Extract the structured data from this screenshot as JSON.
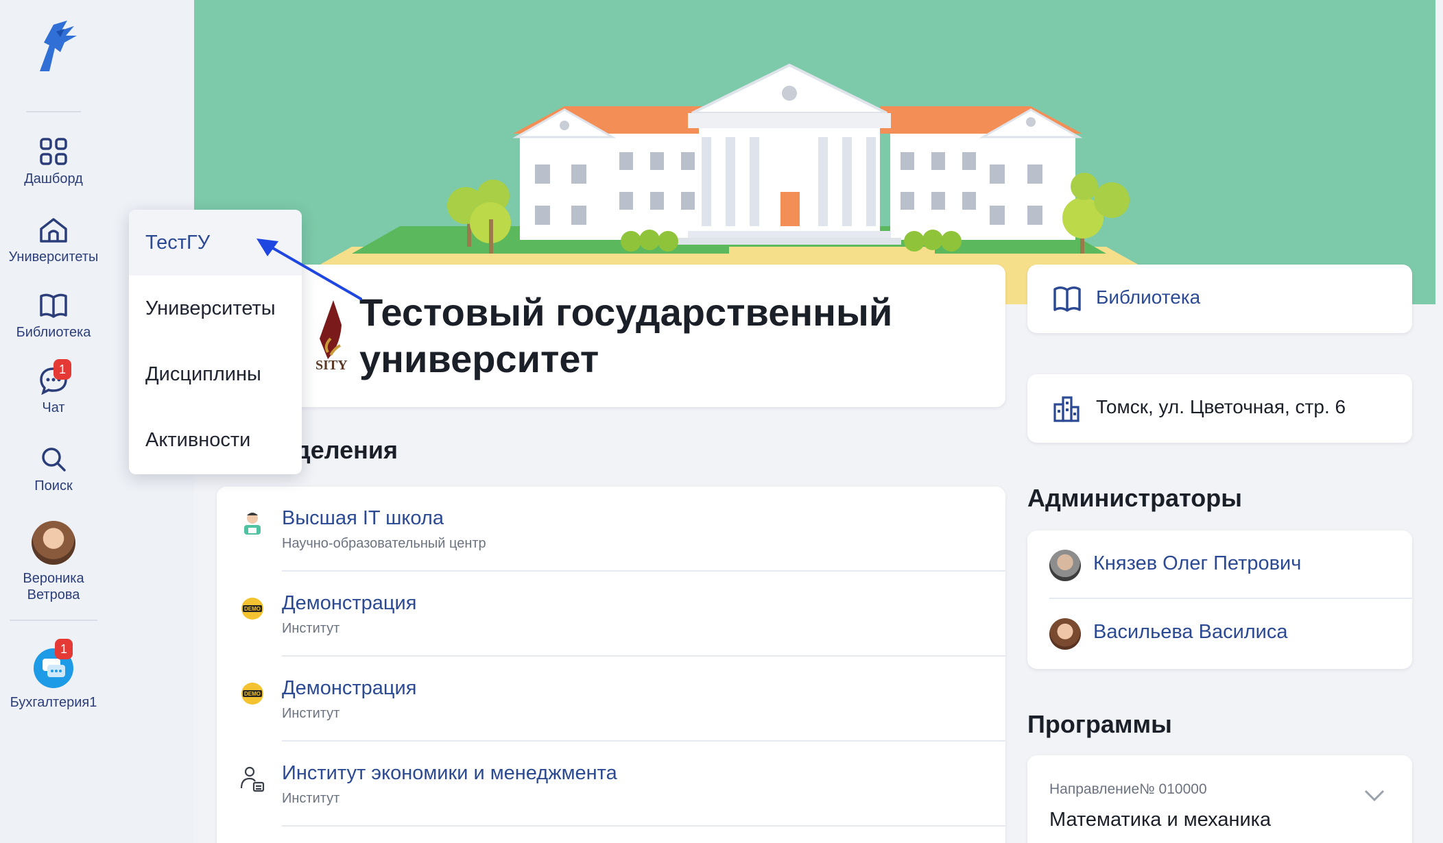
{
  "sidebar": {
    "items": [
      {
        "label": "Дашборд",
        "icon": "dashboard-grid-icon"
      },
      {
        "label": "Университеты",
        "icon": "university-home-icon"
      },
      {
        "label": "Библиотека",
        "icon": "book-icon"
      },
      {
        "label": "Чат",
        "icon": "chat-icon",
        "badge": "1"
      },
      {
        "label": "Поиск",
        "icon": "search-icon"
      }
    ],
    "user": {
      "first_name": "Вероника",
      "last_name": "Ветрова"
    },
    "bot": {
      "label": "Бухгалтерия1",
      "badge": "1"
    }
  },
  "dropdown": {
    "items": [
      "ТестГУ",
      "Университеты",
      "Дисциплины",
      "Активности"
    ],
    "active_index": 0
  },
  "university": {
    "title_line1": "Тестовый государственный",
    "title_line2": "университет",
    "crest_text": "SITY"
  },
  "links": {
    "library": "Библиотека",
    "address": "Томск, ул. Цветочная, стр. 6"
  },
  "sections": {
    "departments_heading": "зделения",
    "admins_heading": "Администраторы",
    "programs_heading": "Программы"
  },
  "departments": [
    {
      "name": "Высшая IT школа",
      "type": "Научно-образовательный центр"
    },
    {
      "name": "Демонстрация",
      "type": "Институт"
    },
    {
      "name": "Демонстрация",
      "type": "Институт"
    },
    {
      "name": "Институт экономики и менеджмента",
      "type": "Институт"
    }
  ],
  "admins": [
    {
      "name": "Князев Олег Петрович"
    },
    {
      "name": "Васильева Василиса"
    }
  ],
  "program": {
    "number": "Направление№ 010000",
    "name": "Математика и механика"
  },
  "colors": {
    "accent": "#2c4a93",
    "banner": "#7ccaa9",
    "badge": "#e53935"
  }
}
